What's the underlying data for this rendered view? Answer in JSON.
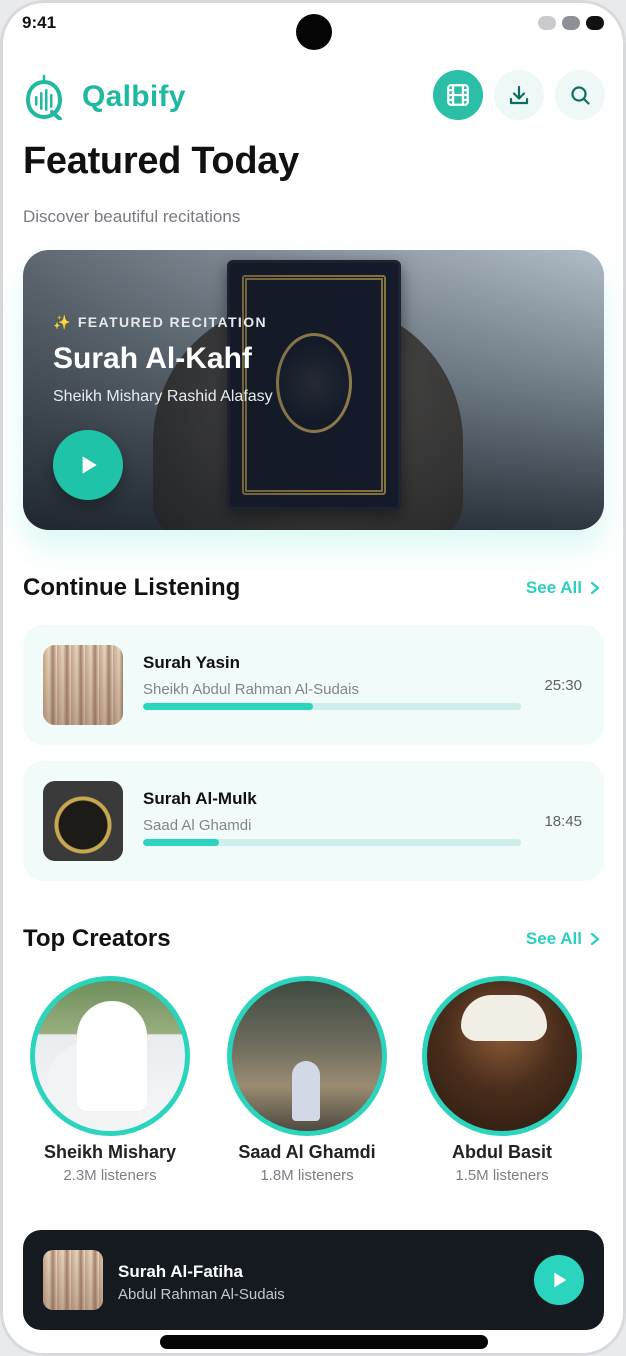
{
  "status": {
    "time": "9:41"
  },
  "header": {
    "brand": "Qalbify",
    "logo_icon": "mosque-audio-logo-icon",
    "actions": [
      {
        "icon": "film-icon",
        "active": true
      },
      {
        "icon": "download-icon",
        "active": false
      },
      {
        "icon": "search-icon",
        "active": false
      }
    ]
  },
  "page": {
    "title": "Featured Today",
    "subtitle": "Discover beautiful recitations"
  },
  "featured": {
    "tag": "FEATURED RECITATION",
    "tag_icon": "sparkle-icon",
    "title": "Surah Al-Kahf",
    "reciter": "Sheikh Mishary Rashid Alafasy"
  },
  "continue_listening": {
    "title": "Continue Listening",
    "see_all": "See All",
    "items": [
      {
        "name": "Surah Yasin",
        "artist": "Sheikh Abdul Rahman Al-Sudais",
        "time": "25:30",
        "progress": 0.45
      },
      {
        "name": "Surah Al-Mulk",
        "artist": "Saad Al Ghamdi",
        "time": "18:45",
        "progress": 0.2
      }
    ]
  },
  "top_creators": {
    "title": "Top Creators",
    "see_all": "See All",
    "items": [
      {
        "name": "Sheikh Mishary",
        "listeners": "2.3M listeners"
      },
      {
        "name": "Saad Al Ghamdi",
        "listeners": "1.8M listeners"
      },
      {
        "name": "Abdul Basit",
        "listeners": "1.5M listeners"
      }
    ]
  },
  "mini_player": {
    "title": "Surah Al-Fatiha",
    "artist": "Abdul Rahman Al-Sudais"
  },
  "colors": {
    "accent": "#2bd4bd",
    "brand": "#1fb8a0",
    "card_bg": "#f1fbfa",
    "player_bg": "#151a21"
  }
}
